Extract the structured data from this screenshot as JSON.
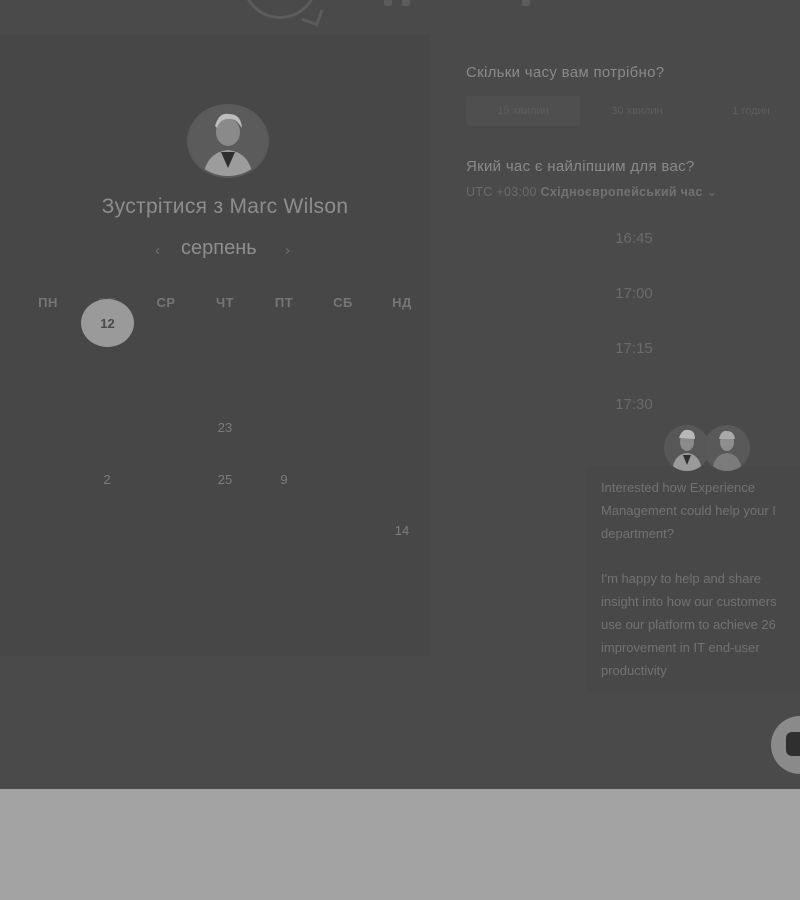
{
  "calendar": {
    "title": "Зустрітися з Marc Wilson",
    "month": "серпень",
    "prev_arrow": "‹",
    "next_arrow": "›",
    "weekdays": [
      "ПН",
      "ВТ",
      "СР",
      "ЧТ",
      "ПТ",
      "СБ",
      "НД"
    ],
    "selected_day": "12",
    "days": [
      {
        "label": "23",
        "state": "available"
      },
      {
        "label": "2",
        "state": "available"
      },
      {
        "label": "25",
        "state": "available"
      },
      {
        "label": "9",
        "state": "available"
      },
      {
        "label": "14",
        "state": "available"
      }
    ]
  },
  "scheduler": {
    "duration_question": "Скільки часу вам потрібно?",
    "durations": [
      "15 хвилин",
      "30 хвилин",
      "1 годин"
    ],
    "time_question": "Який час є найліпшим для вас?",
    "timezone_offset": "UTC +03:00",
    "timezone_name": "Східноєвропейський час",
    "timezone_caret": "⌄",
    "times": [
      "16:45",
      "17:00",
      "17:15",
      "17:30"
    ]
  },
  "chat": {
    "message_1": "Interested how Experience\nManagement could help your I\ndepartment?",
    "message_2": "I'm happy to help and share\ninsight into how our customers\nuse our platform to achieve 26\nimprovement in IT end-user\nproductivity"
  },
  "colors": {
    "overlay": "#4a4a4a",
    "footer": "#a3a3a3",
    "selected_day": "#9a9a9a"
  }
}
